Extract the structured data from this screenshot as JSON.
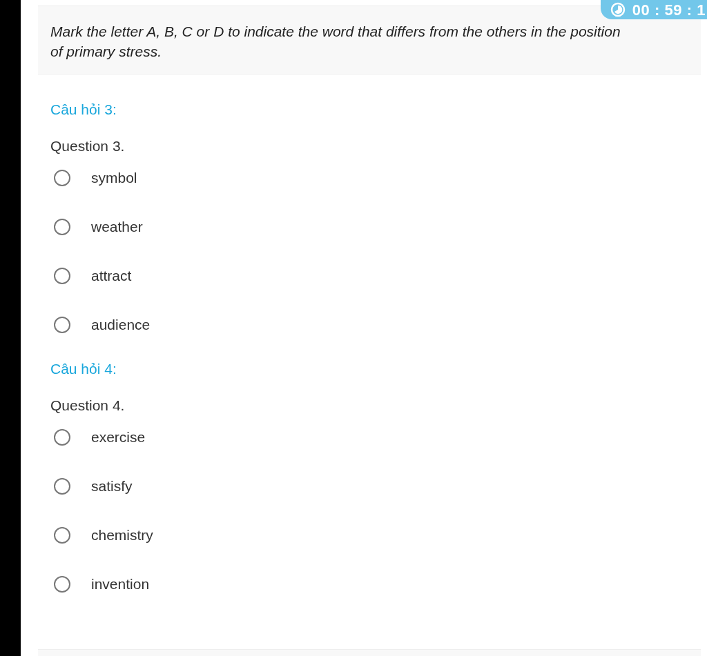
{
  "timer": "00 : 59 : 1",
  "instructions": "Mark the letter A, B, C or D to indicate the word that differs from the others in the position of primary stress.",
  "questions": [
    {
      "heading": "Câu hỏi 3:",
      "prompt": "Question 3.",
      "options": [
        {
          "label": "symbol",
          "selected": false
        },
        {
          "label": "weather",
          "selected": false
        },
        {
          "label": "attract",
          "selected": false
        },
        {
          "label": "audience",
          "selected": false
        }
      ]
    },
    {
      "heading": "Câu hỏi 4:",
      "prompt": "Question 4.",
      "options": [
        {
          "label": "exercise",
          "selected": false
        },
        {
          "label": "satisfy",
          "selected": false
        },
        {
          "label": "chemistry",
          "selected": false
        },
        {
          "label": "invention",
          "selected": false
        }
      ]
    }
  ]
}
